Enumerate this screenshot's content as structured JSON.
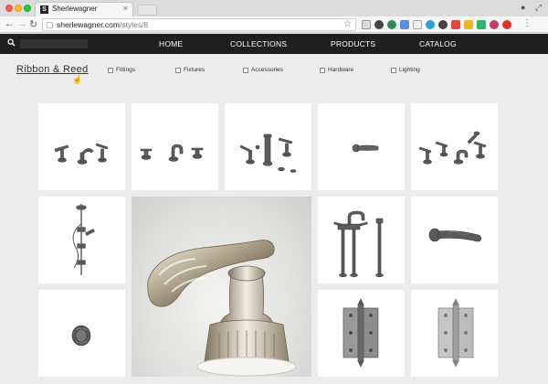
{
  "browser": {
    "tab_title": "Sherlewagner",
    "url_host": "sherlewagner.com",
    "url_path": "/styles/8"
  },
  "nav": {
    "items": [
      "HOME",
      "COLLECTIONS",
      "PRODUCTS",
      "CATALOG"
    ]
  },
  "style": {
    "title": "Ribbon & Reed"
  },
  "filters": [
    "Fittings",
    "Fixtures",
    "Accessories",
    "Hardware",
    "Lighting"
  ],
  "products": [
    {
      "icon": "widespread-faucet-icon"
    },
    {
      "icon": "tub-faucet-set-icon"
    },
    {
      "icon": "bidet-set-icon"
    },
    {
      "icon": "lever-handle-icon"
    },
    {
      "icon": "tub-set-handshower-icon"
    },
    {
      "icon": "shower-system-icon"
    },
    {
      "icon": "faucet-closeup-photo"
    },
    {
      "icon": "floor-mount-tub-filler-icon"
    },
    {
      "icon": "door-lever-icon"
    },
    {
      "icon": "door-knob-icon"
    },
    {
      "icon": "brass-hinge-icon"
    },
    {
      "icon": "steel-hinge-icon"
    }
  ]
}
